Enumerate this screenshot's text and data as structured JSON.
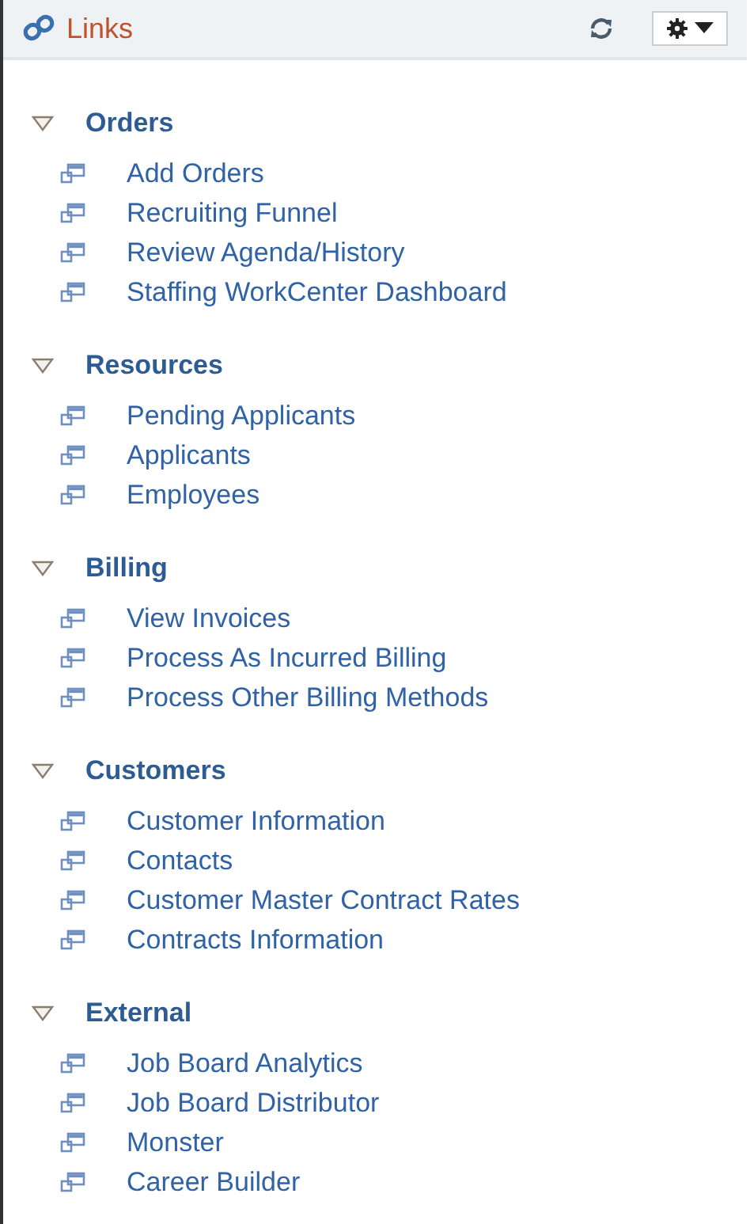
{
  "header": {
    "title": "Links"
  },
  "sections": [
    {
      "title": "Orders",
      "expanded": true,
      "items": [
        "Add Orders",
        "Recruiting Funnel",
        "Review Agenda/History",
        "Staffing WorkCenter Dashboard"
      ]
    },
    {
      "title": "Resources",
      "expanded": true,
      "items": [
        "Pending Applicants",
        "Applicants",
        "Employees"
      ]
    },
    {
      "title": "Billing",
      "expanded": true,
      "items": [
        "View Invoices",
        "Process As Incurred Billing",
        "Process Other Billing Methods"
      ]
    },
    {
      "title": "Customers",
      "expanded": true,
      "items": [
        "Customer Information",
        "Contacts",
        "Customer Master Contract Rates",
        "Contracts Information"
      ]
    },
    {
      "title": "External",
      "expanded": true,
      "items": [
        "Job Board Analytics",
        "Job Board Distributor",
        "Monster",
        "Career Builder"
      ]
    }
  ]
}
